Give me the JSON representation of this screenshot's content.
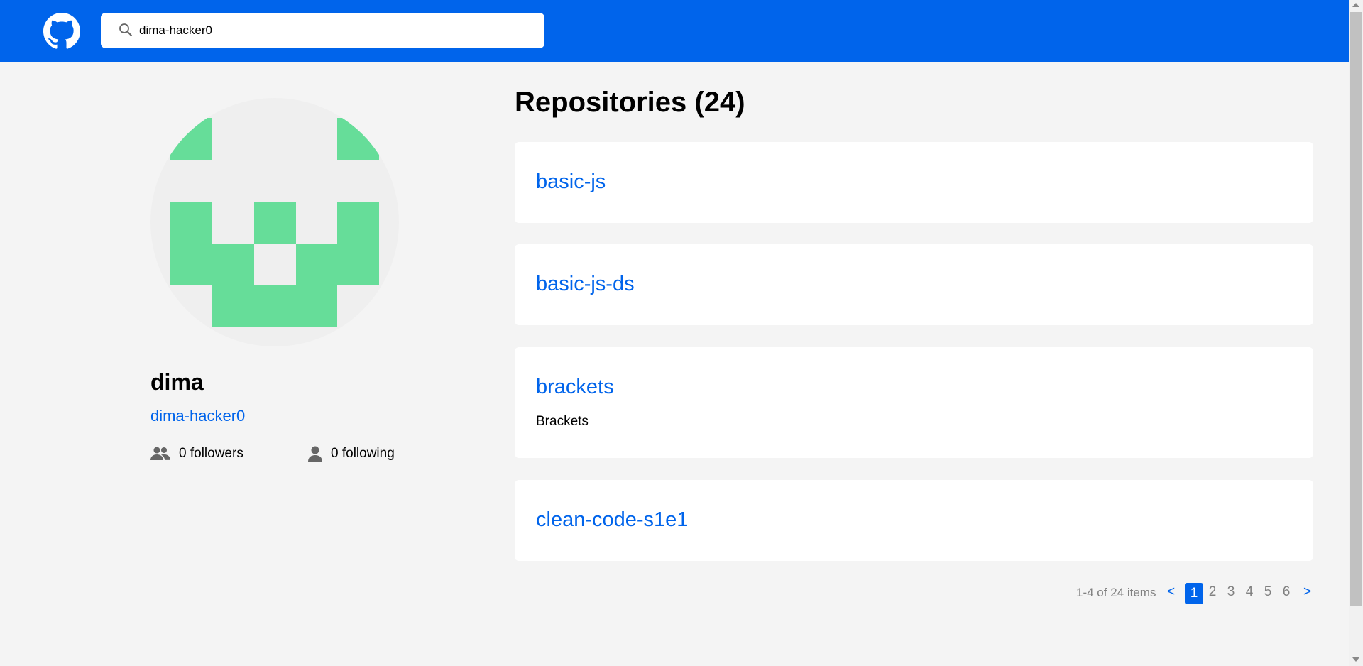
{
  "search": {
    "value": "dima-hacker0"
  },
  "profile": {
    "name": "dima",
    "login": "dima-hacker0",
    "followers": "0 followers",
    "following": "0 following"
  },
  "repositories": {
    "title": "Repositories (24)",
    "items": [
      {
        "name": "basic-js",
        "description": ""
      },
      {
        "name": "basic-js-ds",
        "description": ""
      },
      {
        "name": "brackets",
        "description": "Brackets"
      },
      {
        "name": "clean-code-s1e1",
        "description": ""
      }
    ]
  },
  "pagination": {
    "info": "1-4 of 24 items",
    "prev": "<",
    "next": ">",
    "pages": [
      "1",
      "2",
      "3",
      "4",
      "5",
      "6"
    ],
    "current": "1"
  },
  "colors": {
    "header": "#0064eb",
    "accent": "#0064eb",
    "avatar_fill": "#66dd99",
    "background": "#f4f4f4"
  },
  "icons": {
    "logo": "github-icon",
    "search": "search-icon",
    "followers": "people-icon",
    "following": "person-icon"
  }
}
